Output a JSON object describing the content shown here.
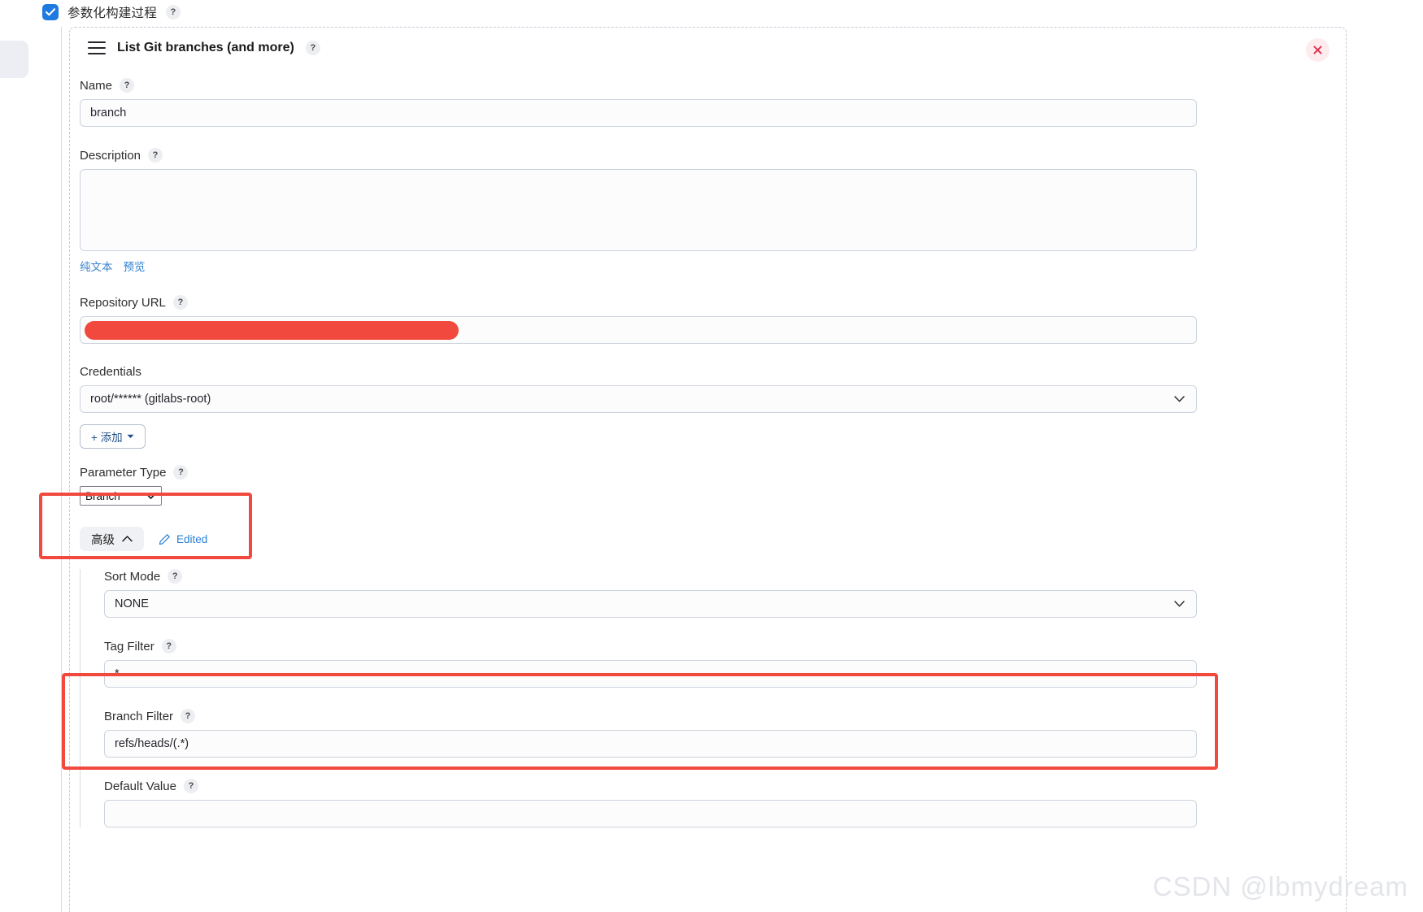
{
  "top": {
    "checkbox_label": "参数化构建过程",
    "checkbox_checked": true,
    "help_glyph": "?"
  },
  "card": {
    "title": "List Git branches (and more)",
    "help_glyph": "?",
    "close_glyph": "✕"
  },
  "fields": {
    "name": {
      "label": "Name",
      "value": "branch",
      "placeholder": ""
    },
    "description": {
      "label": "Description",
      "value": "",
      "placeholder": "",
      "links": [
        "纯文本",
        "预览"
      ]
    },
    "repository_url": {
      "label": "Repository URL",
      "value": "",
      "placeholder": "",
      "redacted": true
    },
    "credentials": {
      "label": "Credentials",
      "value": "root/****** (gitlabs-root)",
      "add_button": "+ 添加"
    },
    "parameter_type": {
      "label": "Parameter Type",
      "value": "Branch"
    },
    "advanced": {
      "toggle_label": "高级",
      "toggle_caret": "⌃",
      "edited_label": "Edited"
    },
    "sort_mode": {
      "label": "Sort Mode",
      "value": "NONE"
    },
    "tag_filter": {
      "label": "Tag Filter",
      "value": "*"
    },
    "branch_filter": {
      "label": "Branch Filter",
      "value": "refs/heads/(.*)"
    },
    "default_value": {
      "label": "Default Value",
      "value": ""
    }
  },
  "watermark": "CSDN @lbmydream",
  "colors": {
    "accent": "#1f7ae0",
    "annotation_red": "#f2493e",
    "link_blue": "#2a7fd4"
  }
}
